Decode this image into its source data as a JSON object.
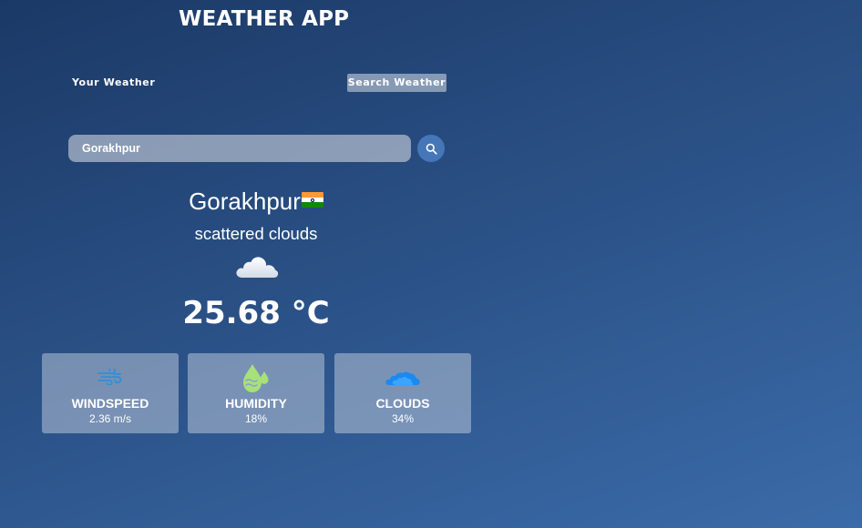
{
  "app": {
    "title": "WEATHER APP"
  },
  "tabs": {
    "your_weather": "Your Weather",
    "search_weather": "Search Weather"
  },
  "search": {
    "value": "Gorakhpur"
  },
  "weather": {
    "city": "Gorakhpur",
    "country_flag": "india-flag",
    "description": "scattered clouds",
    "condition_icon": "cloud-icon",
    "temperature": "25.68 °C"
  },
  "cards": [
    {
      "label": "WINDSPEED",
      "value": "2.36 m/s",
      "icon": "wind-icon"
    },
    {
      "label": "HUMIDITY",
      "value": "18%",
      "icon": "humidity-icon"
    },
    {
      "label": "CLOUDS",
      "value": "34%",
      "icon": "clouds-icon"
    }
  ],
  "colors": {
    "background_top": "#1b3966",
    "background_bottom": "#3b6ba9",
    "search_button": "#4577b8",
    "wind_icon": "#2f8fd8",
    "humidity_icon": "#a8e07a",
    "clouds_icon": "#1a8af0",
    "flag_saffron": "#ff9933",
    "flag_white": "#ffffff",
    "flag_green": "#138808",
    "flag_wheel": "#000080"
  }
}
